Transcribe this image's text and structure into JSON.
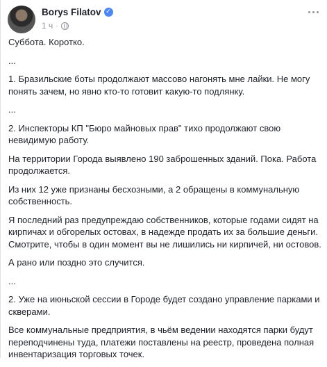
{
  "post": {
    "author": "Borys Filatov",
    "time": "1 ч",
    "separator": "·",
    "verified_icon": "check-badge-icon",
    "privacy_icon": "globe-icon",
    "menu_icon": "more-horizontal-icon",
    "paragraphs": [
      "Суббота. Коротко.",
      "...",
      "1. Бразильские боты продолжают массово нагонять мне лайки. Не могу понять зачем, но явно кто-то готовит какую-то подлянку.",
      "...",
      "2. Инспекторы КП \"Бюро майновых прав\" тихо продолжают свою невидимую работу.",
      "На территории Города выявлено 190 заброшенных зданий. Пока. Работа продолжается.",
      "Из них 12 уже признаны бесхозными, а 2 обращены в коммунальную собственность.",
      "Я последний раз предупреждаю собственников, которые годами сидят на кирпичах и обгорелых остовах, в надежде продать их за большие деньги. Смотрите, чтобы в один момент вы не лишились ни кирпичей, ни остовов.",
      "А рано или поздно это случится.",
      "...",
      "2. Уже на июньской сессии в Городе будет создано управление парками и скверами.",
      "Все коммунальные предприятия, в чьём ведении находятся парки будут переподчинены туда, платежи поставлены на реестр, проведена полная инвентаризация торговых точек."
    ]
  }
}
